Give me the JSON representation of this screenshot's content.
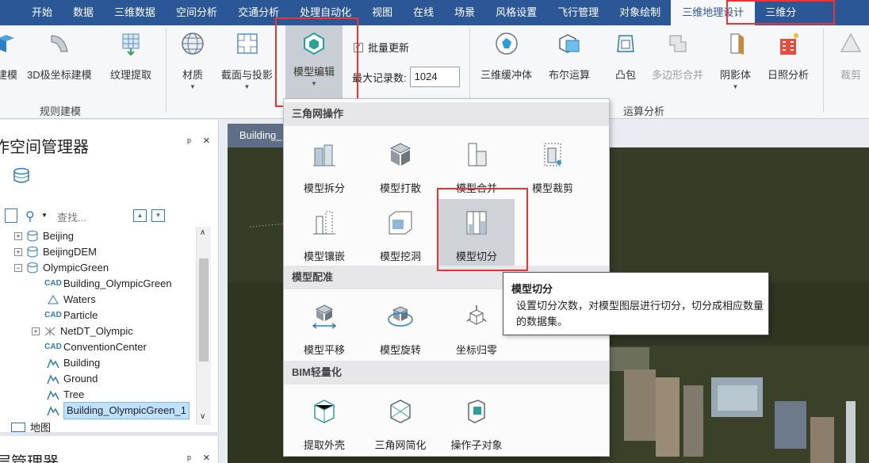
{
  "menubar": {
    "items": [
      "开始",
      "数据",
      "三维数据",
      "空间分析",
      "交通分析",
      "处理自动化",
      "视图",
      "在线",
      "场景",
      "风格设置",
      "飞行管理",
      "对象绘制",
      "三维地理设计",
      "三维分"
    ],
    "active": "三维地理设计"
  },
  "ribbon": {
    "buttons": {
      "b0": "建模",
      "b1": "3D极坐标建模",
      "b2": "纹理提取",
      "b3": "材质",
      "b4": "截面与投影",
      "b5": "模型编辑",
      "b6": "三维缓冲体",
      "b7": "布尔运算",
      "b8": "凸包",
      "b9": "多边形合并",
      "b10": "阴影体",
      "b11": "日照分析",
      "b12": "裁剪"
    },
    "batch_update_label": "批量更新",
    "batch_update_checked": true,
    "max_records_label": "最大记录数:",
    "max_records_value": "1024",
    "groups": {
      "g1": "规则建模",
      "g2": "运算分析"
    }
  },
  "left_panel": {
    "title": "工作空间管理器",
    "pin": "ᵖ",
    "close": "×",
    "search_placeholder": "查找...",
    "tree": [
      {
        "label": "Beijing",
        "icon": "datasource-icon"
      },
      {
        "label": "BeijingDEM",
        "icon": "datasource-icon"
      },
      {
        "label": "OlympicGreen",
        "icon": "datasource-icon"
      },
      {
        "label": "Building_OlympicGreen",
        "icon": "cad-icon"
      },
      {
        "label": "Waters",
        "icon": "region-icon"
      },
      {
        "label": "Particle",
        "icon": "cad-icon"
      },
      {
        "label": "NetDT_Olympic",
        "icon": "network-icon"
      },
      {
        "label": "ConventionCenter",
        "icon": "cad-icon"
      },
      {
        "label": "Building",
        "icon": "model-icon"
      },
      {
        "label": "Ground",
        "icon": "model-icon"
      },
      {
        "label": "Tree",
        "icon": "model-icon"
      },
      {
        "label": "Building_OlympicGreen_1",
        "icon": "model-icon"
      }
    ],
    "bottom_row": "地图",
    "bottom_title": "图层管理器"
  },
  "map": {
    "tab_label": "Building_"
  },
  "dropdown": {
    "sections": {
      "s1": "三角网操作",
      "s2": "模型配准",
      "s3": "BIM轻量化"
    },
    "items": {
      "split": "模型拆分",
      "scatter": "模型打散",
      "merge": "模型合并",
      "clip": "模型裁剪",
      "inlay": "模型镶嵌",
      "hole": "模型挖洞",
      "cut": "模型切分",
      "translate": "模型平移",
      "rotate": "模型旋转",
      "origin": "坐标归零",
      "shell": "提取外壳",
      "simplify": "三角网简化",
      "subobject": "操作子对象"
    }
  },
  "tooltip": {
    "title": "模型切分",
    "body": "设置切分次数，对模型图层进行切分，切分成相应数量的数据集。"
  },
  "colors": {
    "menubar": "#2b5797",
    "highlight": "#e33333",
    "selection": "#bfe0ff"
  }
}
